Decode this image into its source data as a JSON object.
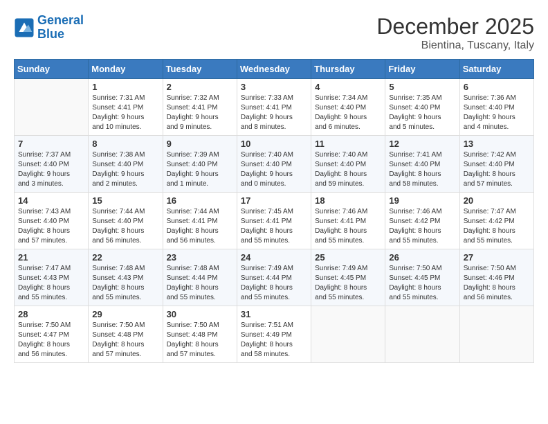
{
  "header": {
    "logo_line1": "General",
    "logo_line2": "Blue",
    "month_title": "December 2025",
    "location": "Bientina, Tuscany, Italy"
  },
  "weekdays": [
    "Sunday",
    "Monday",
    "Tuesday",
    "Wednesday",
    "Thursday",
    "Friday",
    "Saturday"
  ],
  "weeks": [
    [
      {
        "day": "",
        "info": ""
      },
      {
        "day": "1",
        "info": "Sunrise: 7:31 AM\nSunset: 4:41 PM\nDaylight: 9 hours\nand 10 minutes."
      },
      {
        "day": "2",
        "info": "Sunrise: 7:32 AM\nSunset: 4:41 PM\nDaylight: 9 hours\nand 9 minutes."
      },
      {
        "day": "3",
        "info": "Sunrise: 7:33 AM\nSunset: 4:41 PM\nDaylight: 9 hours\nand 8 minutes."
      },
      {
        "day": "4",
        "info": "Sunrise: 7:34 AM\nSunset: 4:40 PM\nDaylight: 9 hours\nand 6 minutes."
      },
      {
        "day": "5",
        "info": "Sunrise: 7:35 AM\nSunset: 4:40 PM\nDaylight: 9 hours\nand 5 minutes."
      },
      {
        "day": "6",
        "info": "Sunrise: 7:36 AM\nSunset: 4:40 PM\nDaylight: 9 hours\nand 4 minutes."
      }
    ],
    [
      {
        "day": "7",
        "info": "Sunrise: 7:37 AM\nSunset: 4:40 PM\nDaylight: 9 hours\nand 3 minutes."
      },
      {
        "day": "8",
        "info": "Sunrise: 7:38 AM\nSunset: 4:40 PM\nDaylight: 9 hours\nand 2 minutes."
      },
      {
        "day": "9",
        "info": "Sunrise: 7:39 AM\nSunset: 4:40 PM\nDaylight: 9 hours\nand 1 minute."
      },
      {
        "day": "10",
        "info": "Sunrise: 7:40 AM\nSunset: 4:40 PM\nDaylight: 9 hours\nand 0 minutes."
      },
      {
        "day": "11",
        "info": "Sunrise: 7:40 AM\nSunset: 4:40 PM\nDaylight: 8 hours\nand 59 minutes."
      },
      {
        "day": "12",
        "info": "Sunrise: 7:41 AM\nSunset: 4:40 PM\nDaylight: 8 hours\nand 58 minutes."
      },
      {
        "day": "13",
        "info": "Sunrise: 7:42 AM\nSunset: 4:40 PM\nDaylight: 8 hours\nand 57 minutes."
      }
    ],
    [
      {
        "day": "14",
        "info": "Sunrise: 7:43 AM\nSunset: 4:40 PM\nDaylight: 8 hours\nand 57 minutes."
      },
      {
        "day": "15",
        "info": "Sunrise: 7:44 AM\nSunset: 4:40 PM\nDaylight: 8 hours\nand 56 minutes."
      },
      {
        "day": "16",
        "info": "Sunrise: 7:44 AM\nSunset: 4:41 PM\nDaylight: 8 hours\nand 56 minutes."
      },
      {
        "day": "17",
        "info": "Sunrise: 7:45 AM\nSunset: 4:41 PM\nDaylight: 8 hours\nand 55 minutes."
      },
      {
        "day": "18",
        "info": "Sunrise: 7:46 AM\nSunset: 4:41 PM\nDaylight: 8 hours\nand 55 minutes."
      },
      {
        "day": "19",
        "info": "Sunrise: 7:46 AM\nSunset: 4:42 PM\nDaylight: 8 hours\nand 55 minutes."
      },
      {
        "day": "20",
        "info": "Sunrise: 7:47 AM\nSunset: 4:42 PM\nDaylight: 8 hours\nand 55 minutes."
      }
    ],
    [
      {
        "day": "21",
        "info": "Sunrise: 7:47 AM\nSunset: 4:43 PM\nDaylight: 8 hours\nand 55 minutes."
      },
      {
        "day": "22",
        "info": "Sunrise: 7:48 AM\nSunset: 4:43 PM\nDaylight: 8 hours\nand 55 minutes."
      },
      {
        "day": "23",
        "info": "Sunrise: 7:48 AM\nSunset: 4:44 PM\nDaylight: 8 hours\nand 55 minutes."
      },
      {
        "day": "24",
        "info": "Sunrise: 7:49 AM\nSunset: 4:44 PM\nDaylight: 8 hours\nand 55 minutes."
      },
      {
        "day": "25",
        "info": "Sunrise: 7:49 AM\nSunset: 4:45 PM\nDaylight: 8 hours\nand 55 minutes."
      },
      {
        "day": "26",
        "info": "Sunrise: 7:50 AM\nSunset: 4:45 PM\nDaylight: 8 hours\nand 55 minutes."
      },
      {
        "day": "27",
        "info": "Sunrise: 7:50 AM\nSunset: 4:46 PM\nDaylight: 8 hours\nand 56 minutes."
      }
    ],
    [
      {
        "day": "28",
        "info": "Sunrise: 7:50 AM\nSunset: 4:47 PM\nDaylight: 8 hours\nand 56 minutes."
      },
      {
        "day": "29",
        "info": "Sunrise: 7:50 AM\nSunset: 4:48 PM\nDaylight: 8 hours\nand 57 minutes."
      },
      {
        "day": "30",
        "info": "Sunrise: 7:50 AM\nSunset: 4:48 PM\nDaylight: 8 hours\nand 57 minutes."
      },
      {
        "day": "31",
        "info": "Sunrise: 7:51 AM\nSunset: 4:49 PM\nDaylight: 8 hours\nand 58 minutes."
      },
      {
        "day": "",
        "info": ""
      },
      {
        "day": "",
        "info": ""
      },
      {
        "day": "",
        "info": ""
      }
    ]
  ]
}
